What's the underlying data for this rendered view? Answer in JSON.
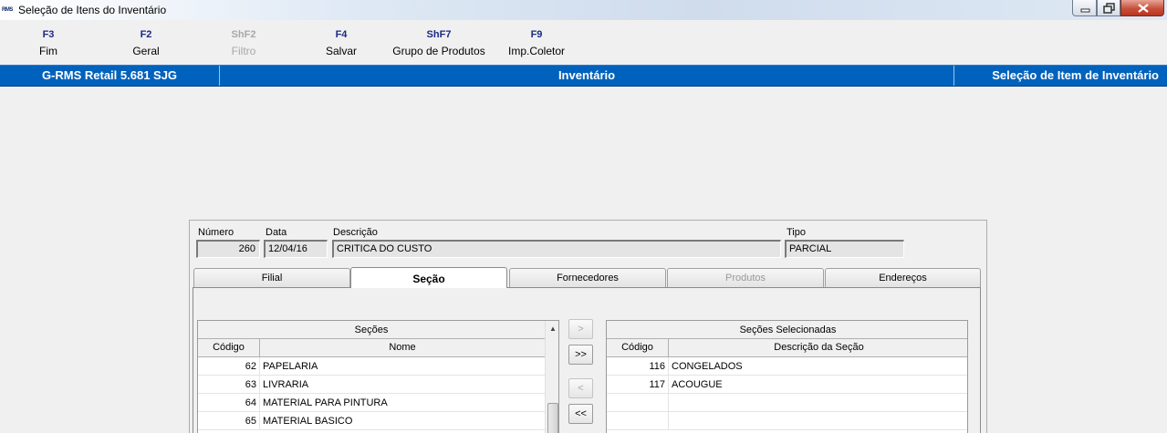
{
  "window": {
    "icon_text": "RMS",
    "title": "Seleção de Itens do Inventário"
  },
  "toolbar": {
    "keys": [
      {
        "key": "F3",
        "label": "Fim"
      },
      {
        "key": "F2",
        "label": "Geral"
      },
      {
        "key": "ShF2",
        "label": "Filtro"
      },
      {
        "key": "F4",
        "label": "Salvar"
      },
      {
        "key": "ShF7",
        "label": "Grupo de Produtos"
      },
      {
        "key": "F9",
        "label": "Imp.Coletor"
      }
    ]
  },
  "header": {
    "left": "G-RMS Retail 5.681 SJG",
    "center": "Inventário",
    "right": "Seleção de Item de Inventário"
  },
  "form": {
    "numero_label": "Número",
    "numero": "260",
    "data_label": "Data",
    "data": "12/04/16",
    "descricao_label": "Descrição",
    "descricao": "CRITICA DO CUSTO",
    "tipo_label": "Tipo",
    "tipo": "PARCIAL"
  },
  "tabs": [
    "Filial",
    "Seção",
    "Fornecedores",
    "Produtos",
    "Endereços"
  ],
  "secoes": {
    "title": "Seções",
    "col_codigo": "Código",
    "col_nome": "Nome",
    "rows": [
      {
        "codigo": "62",
        "nome": "PAPELARIA"
      },
      {
        "codigo": "63",
        "nome": "LIVRARIA"
      },
      {
        "codigo": "64",
        "nome": "MATERIAL PARA PINTURA"
      },
      {
        "codigo": "65",
        "nome": "MATERIAL BASICO"
      }
    ]
  },
  "buttons": {
    "add_one": ">",
    "add_all": ">>",
    "remove_one": "<",
    "remove_all": "<<"
  },
  "selecionadas": {
    "title": "Seções Selecionadas",
    "col_codigo": "Código",
    "col_descricao": "Descrição da Seção",
    "rows": [
      {
        "codigo": "116",
        "descricao": "CONGELADOS"
      },
      {
        "codigo": "117",
        "descricao": "ACOUGUE"
      }
    ]
  }
}
